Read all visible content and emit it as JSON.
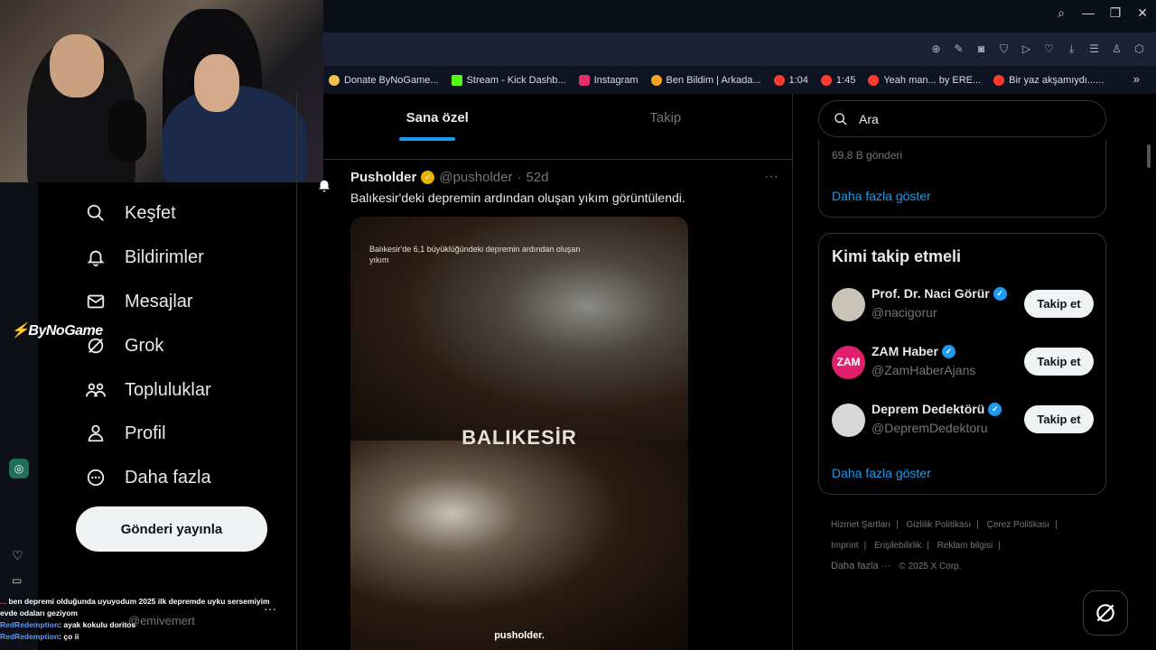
{
  "browser": {
    "bookmarks": [
      {
        "label": "Donate ByNoGame...",
        "color": "#f2c14e"
      },
      {
        "label": "Stream - Kick Dashb...",
        "color": "#53fc18"
      },
      {
        "label": "Instagram",
        "color": "#e1306c"
      },
      {
        "label": "Ben Bildim | Arkada...",
        "color": "#f5a623"
      },
      {
        "label": "1:04",
        "color": "#ff3b30"
      },
      {
        "label": "1:45",
        "color": "#ff3b30"
      },
      {
        "label": "Yeah man... by ERE...",
        "color": "#ff3b30"
      },
      {
        "label": "Bir yaz akşamıydı......",
        "color": "#ff3b30"
      }
    ],
    "overflow": "»"
  },
  "overlay": {
    "brand": "ByNoGame"
  },
  "nav": {
    "items": [
      {
        "label": "Keşfet",
        "icon": "search-icon"
      },
      {
        "label": "Bildirimler",
        "icon": "bell-icon"
      },
      {
        "label": "Mesajlar",
        "icon": "mail-icon"
      },
      {
        "label": "Grok",
        "icon": "grok-icon"
      },
      {
        "label": "Topluluklar",
        "icon": "communities-icon"
      },
      {
        "label": "Profil",
        "icon": "person-icon"
      },
      {
        "label": "Daha fazla",
        "icon": "more-circle-icon"
      }
    ],
    "post_button": "Gönderi yayınla",
    "account_handle": "@emivemert"
  },
  "chat": [
    {
      "user": "...",
      "text": "ben depremi olduğunda uyuyodum 2025 ilk depremde uyku sersemiyim evde odaları geziyom"
    },
    {
      "user": "RedRedemption",
      "text": ": ayak kokulu doritos"
    },
    {
      "user": "RedRedemption",
      "text": ": ço ii"
    }
  ],
  "feed": {
    "tabs": [
      "Sana özel",
      "Takip"
    ],
    "active_tab": 0,
    "tweet": {
      "author": "Pusholder",
      "handle": "@pusholder",
      "time": "52d",
      "text": "Balıkesir'deki depremin ardından oluşan yıkım görüntülendi.",
      "media_caption": "Balıkesir'de 6,1 büyüklüğündeki depremin ardından oluşan yıkım",
      "media_title": "BALIKESİR",
      "media_brand": "pusholder."
    }
  },
  "right": {
    "search_placeholder": "Ara",
    "trend_count": "69,8 B gönderi",
    "show_more": "Daha fazla göster",
    "follow_title": "Kimi takip etmeli",
    "follow": [
      {
        "name": "Prof. Dr. Naci Görür",
        "handle": "@nacigorur",
        "button": "Takip et",
        "avatar_color": "#c9c3b8"
      },
      {
        "name": "ZAM Haber",
        "handle": "@ZamHaberAjans",
        "button": "Takip et",
        "avatar_color": "#e0206d"
      },
      {
        "name": "Deprem Dedektörü",
        "handle": "@DepremDedektoru",
        "button": "Takip et",
        "avatar_color": "#d8d8d8"
      }
    ],
    "show_more_2": "Daha fazla göster",
    "footer": [
      "Hizmet Şartları",
      "Gizlilik Politikası",
      "Çerez Politikası",
      "Imprint",
      "Erişilebilirlik",
      "Reklam bilgisi",
      "Daha fazla ···",
      "© 2025 X Corp."
    ]
  },
  "colors": {
    "accent": "#1d9bf0",
    "background": "#000000",
    "border": "#2f3336"
  }
}
